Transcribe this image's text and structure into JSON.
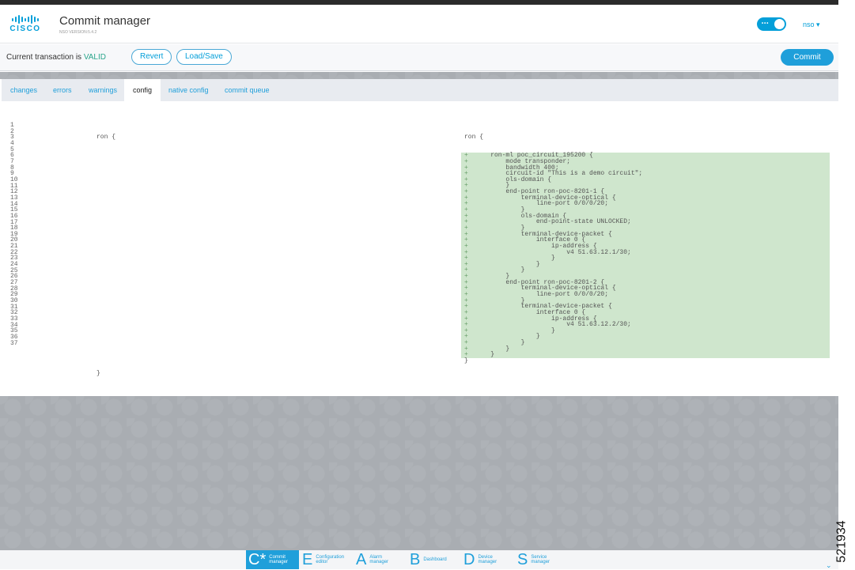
{
  "header": {
    "logo_text": "cisco",
    "title": "Commit manager",
    "version": "NSO VERSION:5.4.2",
    "toggle_state": "on",
    "user": "nso ▾"
  },
  "transaction": {
    "status_prefix": "Current transaction is ",
    "status_value": "VALID",
    "revert_label": "Revert",
    "loadsave_label": "Load/Save",
    "commit_label": "Commit"
  },
  "tabs": [
    {
      "label": "changes",
      "active": false
    },
    {
      "label": "errors",
      "active": false
    },
    {
      "label": "warnings",
      "active": false
    },
    {
      "label": "config",
      "active": true
    },
    {
      "label": "native config",
      "active": false
    },
    {
      "label": "commit queue",
      "active": false
    }
  ],
  "config": {
    "line_numbers": "1\n2\n3\n4\n5\n6\n7\n8\n9\n10\n11\n12\n13\n14\n15\n16\n17\n18\n19\n20\n21\n22\n23\n24\n25\n26\n27\n28\n29\n30\n31\n32\n33\n34\n35\n36\n37",
    "left": {
      "first": "ron {",
      "last": "}"
    },
    "right": {
      "open": "ron {",
      "added_lines": [
        "    ron-ml poc_circuit_195200 {",
        "        mode transponder;",
        "        bandwidth 400;",
        "        circuit-id \"This is a demo circuit\";",
        "        ols-domain {",
        "        }",
        "        end-point ron-poc-8201-1 {",
        "            terminal-device-optical {",
        "                line-port 0/0/0/20;",
        "            }",
        "            ols-domain {",
        "                end-point-state UNLOCKED;",
        "            }",
        "            terminal-device-packet {",
        "                interface 0 {",
        "                    ip-address {",
        "                        v4 51.63.12.1/30;",
        "                    }",
        "                }",
        "            }",
        "        }",
        "        end-point ron-poc-8201-2 {",
        "            terminal-device-optical {",
        "                line-port 0/0/0/20;",
        "            }",
        "            terminal-device-packet {",
        "                interface 0 {",
        "                    ip-address {",
        "                        v4 51.63.12.2/30;",
        "                    }",
        "                }",
        "            }",
        "        }",
        "    }"
      ],
      "close": "}",
      "plus": "+"
    }
  },
  "nav": [
    {
      "letter": "C*",
      "label": "Commit\nmanager",
      "active": true
    },
    {
      "letter": "E",
      "label": "Configuration\neditor",
      "active": false
    },
    {
      "letter": "A",
      "label": "Alarm\nmanager",
      "active": false
    },
    {
      "letter": "B",
      "label": "Dashboard",
      "active": false
    },
    {
      "letter": "D",
      "label": "Device\nmanager",
      "active": false
    },
    {
      "letter": "S",
      "label": "Service\nmanager",
      "active": false
    }
  ],
  "nav_expand_icon": "⌄",
  "figure_id": "521934",
  "colors": {
    "accent": "#1f9fda",
    "valid": "#2aa58b",
    "added_bg": "#cfe6cd"
  }
}
